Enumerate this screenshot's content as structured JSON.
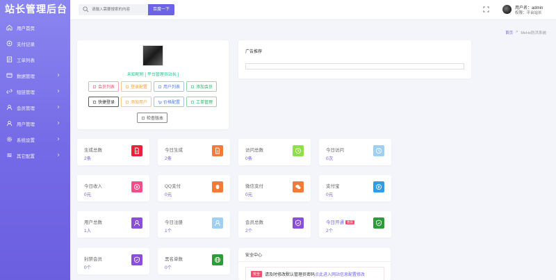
{
  "brand": {
    "title": "站长管理后台"
  },
  "sidebar": {
    "items": [
      {
        "label": "用户首页",
        "icon": "home-icon",
        "has_arrow": false
      },
      {
        "label": "支付记录",
        "icon": "payment-icon",
        "has_arrow": false
      },
      {
        "label": "工单列表",
        "icon": "ticket-icon",
        "has_arrow": false
      },
      {
        "label": "数据管理",
        "icon": "data-icon",
        "has_arrow": true
      },
      {
        "label": "短链管理",
        "icon": "link-icon",
        "has_arrow": true
      },
      {
        "label": "会员管理",
        "icon": "member-icon",
        "has_arrow": true
      },
      {
        "label": "用户管理",
        "icon": "user-icon",
        "has_arrow": true
      },
      {
        "label": "系统设置",
        "icon": "gear-icon",
        "has_arrow": true
      },
      {
        "label": "其它配置",
        "icon": "config-icon",
        "has_arrow": true
      }
    ]
  },
  "topbar": {
    "search_placeholder": "请输入需要搜索的内容",
    "search_button": "百度一下",
    "user_line1": "用户名：admin",
    "user_line2": "权限：平台站长"
  },
  "breadcrumb": {
    "home": "首页",
    "separator": ">",
    "current": "MeHe防洪系统"
  },
  "profile": {
    "nickname": "未知昵称 [ 平台管理员站长 ]",
    "buttons": [
      {
        "label": "会员列表",
        "color": "red",
        "icon": "member-list-icon"
      },
      {
        "label": "登录配置",
        "color": "orange",
        "icon": "login-config-icon"
      },
      {
        "label": "用户列表",
        "color": "blue",
        "icon": "user-list-icon"
      },
      {
        "label": "添加会员",
        "color": "green",
        "icon": "add-member-icon"
      },
      {
        "label": "快捷登录",
        "color": "dark",
        "icon": "quick-login-icon"
      },
      {
        "label": "添加用户",
        "color": "orange",
        "icon": "add-user-icon"
      },
      {
        "label": "价格配置",
        "color": "blue",
        "icon": "cart-icon"
      },
      {
        "label": "工单管理",
        "color": "green",
        "icon": "ticket-manage-icon"
      },
      {
        "label": "检查版本",
        "color": "gray",
        "icon": "check-version-icon"
      }
    ]
  },
  "ad": {
    "title": "广告推荐"
  },
  "stats": [
    {
      "label": "生成总数",
      "value": "2条",
      "icon": "file-icon",
      "color": "#e8223a"
    },
    {
      "label": "今日生成",
      "value": "2条",
      "icon": "file-icon",
      "color": "#f47a3a"
    },
    {
      "label": "访问总数",
      "value": "0条",
      "icon": "clock-icon",
      "color": "#8ee04a"
    },
    {
      "label": "今日访问",
      "value": "0次",
      "icon": "clock-icon",
      "color": "#9fd0f3"
    },
    {
      "label": "今日收入",
      "value": "0元",
      "icon": "income-icon",
      "color": "#f0508a"
    },
    {
      "label": "QQ支付",
      "value": "0元",
      "icon": "qq-icon",
      "color": "#f47a3a"
    },
    {
      "label": "微信支付",
      "value": "0元",
      "icon": "wechat-icon",
      "color": "#f47a3a"
    },
    {
      "label": "支付宝",
      "value": "0元",
      "icon": "alipay-icon",
      "color": "#2f9de8"
    },
    {
      "label": "用户总数",
      "value": "1人",
      "icon": "user-icon",
      "color": "#8a4ed8"
    },
    {
      "label": "今日注册",
      "value": "1个",
      "icon": "user-icon",
      "color": "#9fd0f3"
    },
    {
      "label": "会员总数",
      "value": "2个",
      "icon": "shield-icon",
      "color": "#8a4ed8"
    },
    {
      "label": "今日开通",
      "value": "2个",
      "icon": "shield-icon",
      "color": "#2f9a3a",
      "tag": "会员",
      "highlight": true
    },
    {
      "label": "封禁会员",
      "value": "0个",
      "icon": "shield-icon",
      "color": "#8a4ed8"
    },
    {
      "label": "黑名单数",
      "value": "0个",
      "icon": "globe-icon",
      "color": "#2f9a3a"
    }
  ],
  "security": {
    "title": "安全中心",
    "badge": "安全",
    "notice": "请及时修改默认管理员密码",
    "link": "点此进入网站信息配置修改"
  }
}
